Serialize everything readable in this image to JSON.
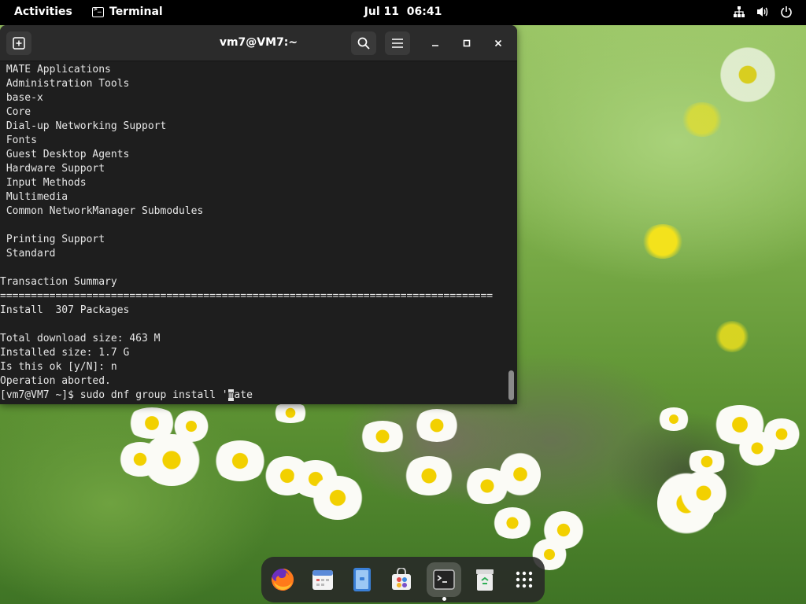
{
  "topbar": {
    "activities": "Activities",
    "app_name": "Terminal",
    "date": "Jul 11",
    "time": "06:41",
    "icons": [
      "network-icon",
      "volume-icon",
      "power-icon"
    ]
  },
  "window": {
    "title": "vm7@VM7:~",
    "buttons": [
      "new-tab-icon",
      "search-icon",
      "hamburger-menu-icon",
      "minimize-icon",
      "maximize-icon",
      "close-icon"
    ]
  },
  "terminal": {
    "lines": [
      " MATE Applications",
      " Administration Tools",
      " base-x",
      " Core",
      " Dial-up Networking Support",
      " Fonts",
      " Guest Desktop Agents",
      " Hardware Support",
      " Input Methods",
      " Multimedia",
      " Common NetworkManager Submodules",
      "",
      " Printing Support",
      " Standard",
      "",
      "Transaction Summary",
      "================================================================================",
      "Install  307 Packages",
      "",
      "Total download size: 463 M",
      "Installed size: 1.7 G",
      "Is this ok [y/N]: n",
      "Operation aborted."
    ],
    "prompt": "[vm7@VM7 ~]$ ",
    "command_before_cursor": "sudo dnf group install '",
    "cursor_char": "m",
    "command_after_cursor": "ate"
  },
  "dock": {
    "items": [
      "firefox-icon",
      "calendar-icon",
      "files-icon",
      "software-icon",
      "terminal-icon",
      "trash-icon",
      "app-grid-icon"
    ],
    "active": "terminal-icon"
  },
  "colors": {
    "terminal_bg": "#1e1e1e",
    "terminal_fg": "#e6e6e6",
    "titlebar_bg": "#2b2b2b",
    "topbar_bg": "#000000"
  }
}
